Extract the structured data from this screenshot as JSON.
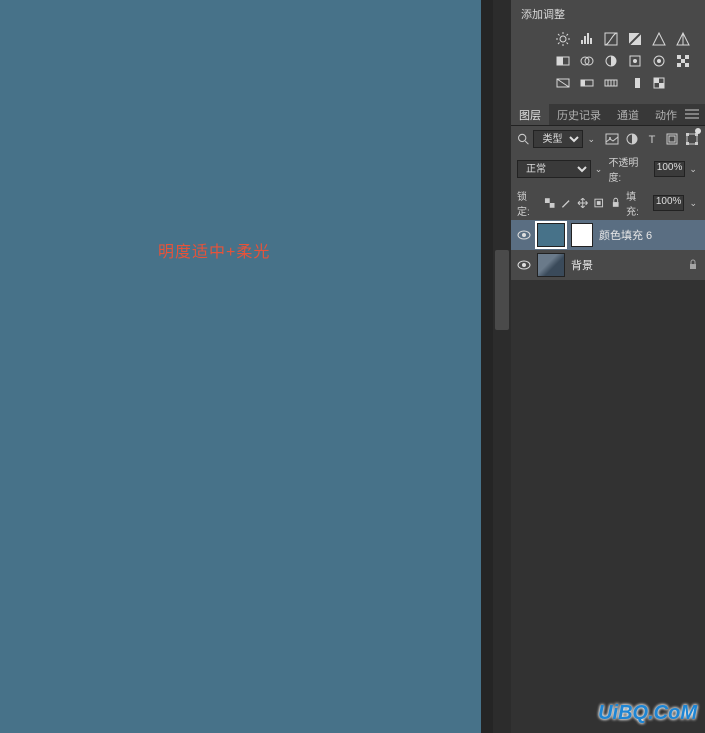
{
  "canvas": {
    "annotation_text": "明度适中+柔光",
    "bg_color": "#477289"
  },
  "adjustments": {
    "title": "添加调整",
    "row1": [
      "brightness",
      "levels",
      "curves",
      "exposure",
      "vibrance",
      "hue"
    ],
    "row2": [
      "bw",
      "photo-filter",
      "channel-mixer",
      "color-lookup",
      "invert",
      "posterize"
    ],
    "row3": [
      "threshold",
      "gradient-map",
      "selective-color",
      "solid",
      "pattern"
    ]
  },
  "tabs": {
    "items": [
      "图层",
      "历史记录",
      "通道",
      "动作"
    ],
    "active_index": 0
  },
  "filter_row": {
    "kind_label": "类型",
    "icons": [
      "image",
      "adjustment",
      "text",
      "shape",
      "smart"
    ]
  },
  "blend": {
    "mode": "正常",
    "opacity_label": "不透明度:",
    "opacity_value": "100%",
    "fill_label": "填充:",
    "fill_value": "100%",
    "lock_label": "锁定:"
  },
  "layers": [
    {
      "name": "颜色填充 6",
      "visible": true,
      "selected": true,
      "has_mask": true,
      "locked": false
    },
    {
      "name": "背景",
      "visible": true,
      "selected": false,
      "has_mask": false,
      "locked": true
    }
  ],
  "watermark": "UiBQ.CoM"
}
